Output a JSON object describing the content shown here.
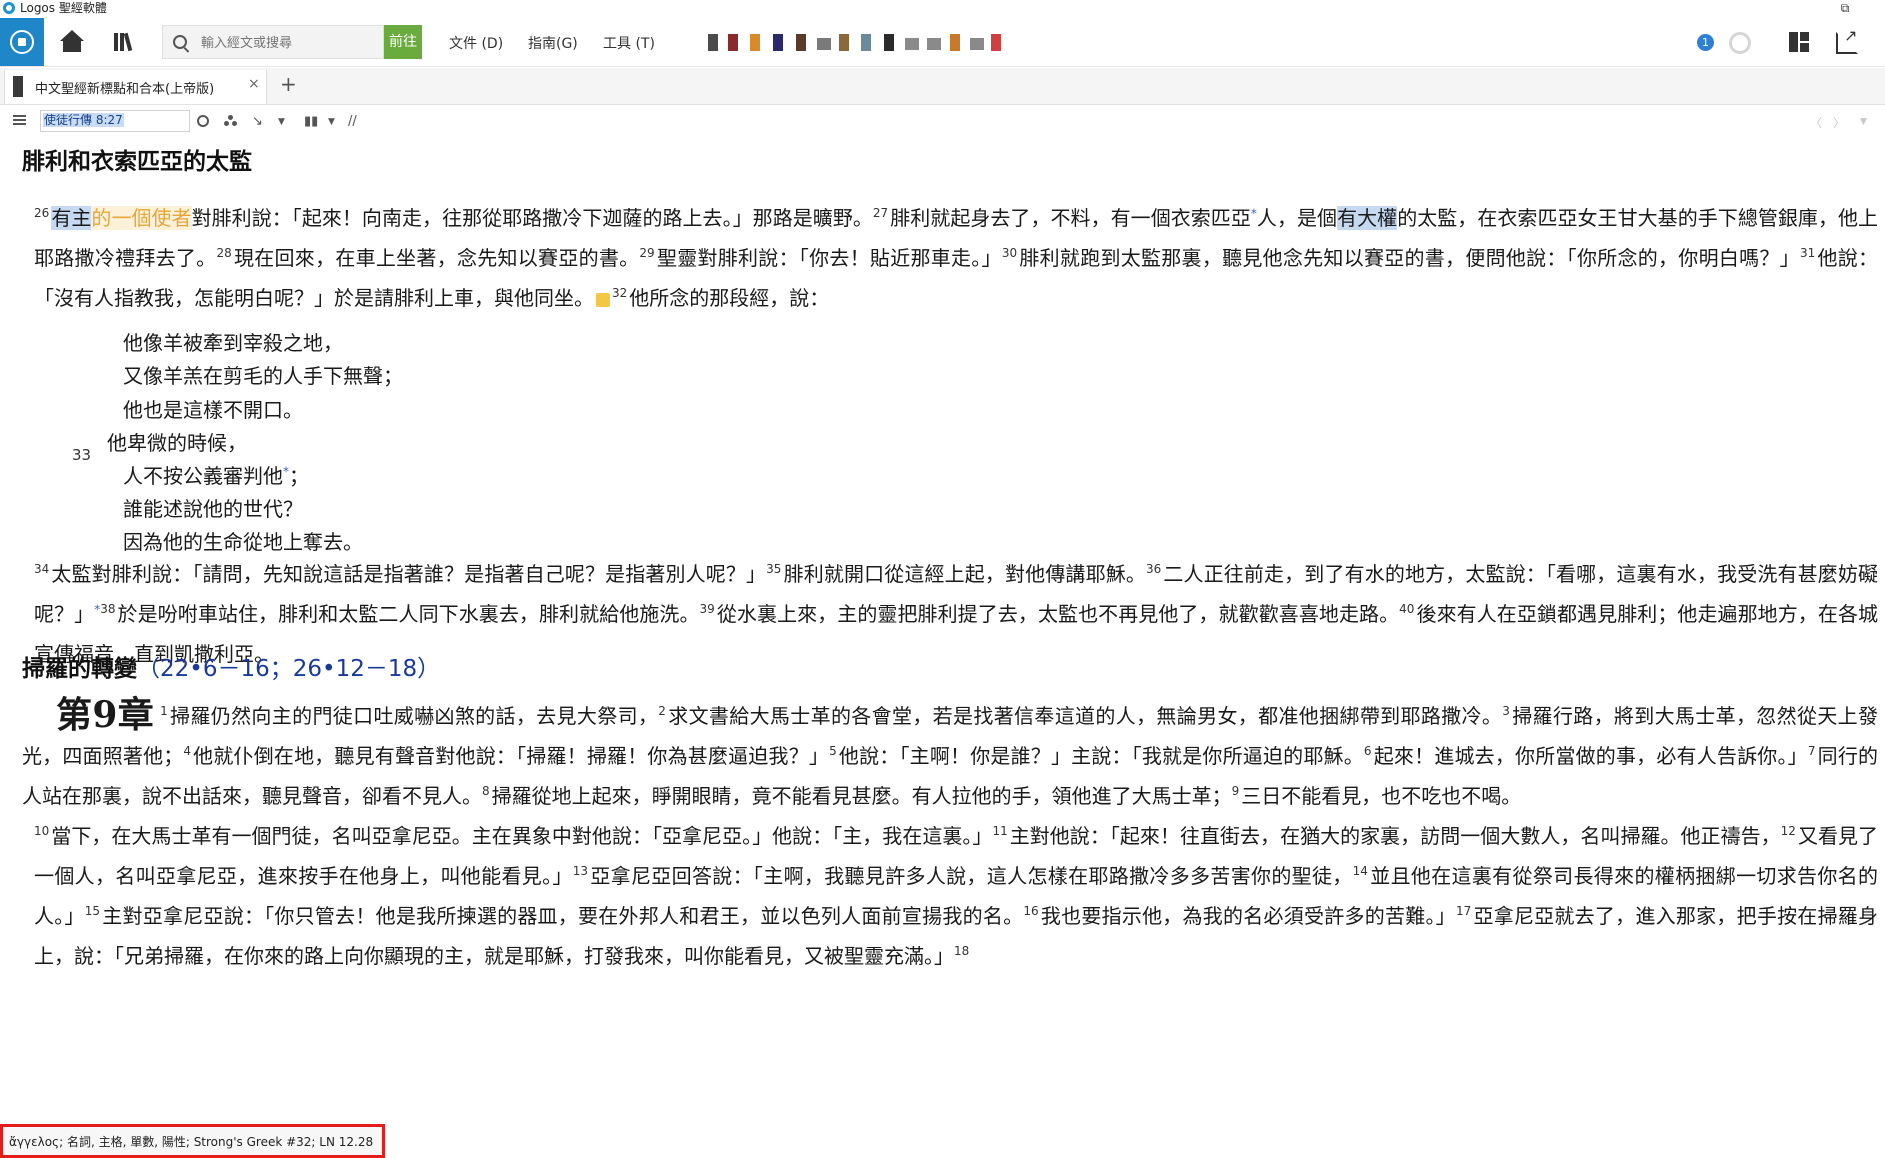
{
  "window": {
    "title": "Logos 聖經軟體",
    "restore_glyph": "⧉"
  },
  "toolbar": {
    "search_placeholder": "輸入經文或搜尋",
    "go_label": "前往",
    "menus": [
      "文件 (D)",
      "指南(G)",
      "工具 (T)"
    ],
    "resource_icons": [
      {
        "name": "resource-icon-1",
        "color": "#4a4a4a"
      },
      {
        "name": "resource-icon-2",
        "color": "#8a2a2a"
      },
      {
        "name": "resource-icon-3",
        "color": "#d98a2b"
      },
      {
        "name": "resource-icon-4",
        "color": "#2a2a6a"
      },
      {
        "name": "resource-icon-5",
        "color": "#5a3a2a"
      },
      {
        "name": "resource-icon-6",
        "color": "#7a7a7a"
      },
      {
        "name": "resource-icon-7",
        "color": "#8a6a3a"
      },
      {
        "name": "resource-icon-8",
        "color": "#6a8a9a"
      },
      {
        "name": "resource-icon-9",
        "color": "#2a2a2a"
      },
      {
        "name": "resource-icon-10",
        "color": "#8a8a8a"
      },
      {
        "name": "resource-icon-11",
        "color": "#8a8a8a"
      },
      {
        "name": "resource-icon-12",
        "color": "#c87a2a"
      },
      {
        "name": "resource-icon-13",
        "color": "#8a8a8a"
      },
      {
        "name": "resource-icon-14",
        "color": "#d04040"
      }
    ],
    "info_badge": "1"
  },
  "tab": {
    "label": "中文聖經新標點和合本(上帝版)",
    "close_glyph": "×",
    "add_glyph": "+"
  },
  "refbar": {
    "reference": "使徒行傳 8:27",
    "separator": "//"
  },
  "content": {
    "heading1": "腓利和衣索匹亞的太監",
    "heading2": "掃羅的轉變",
    "heading2_xref": "（22•6－16；26•12－18）",
    "chapter_label": "第9章",
    "poem_verse_num": "33",
    "poem_lines": [
      "他像羊被牽到宰殺之地，",
      "又像羊羔在剪毛的人手下無聲；",
      "他也是這樣不開口。",
      "他卑微的時候，",
      "人不按公義審判他",
      "誰能述說他的世代？",
      "因為他的生命從地上奪去。"
    ]
  },
  "status": {
    "text": "ἄγγελος; 名詞, 主格, 單數, 陽性; Strong's Greek #32; LN 12.28"
  }
}
